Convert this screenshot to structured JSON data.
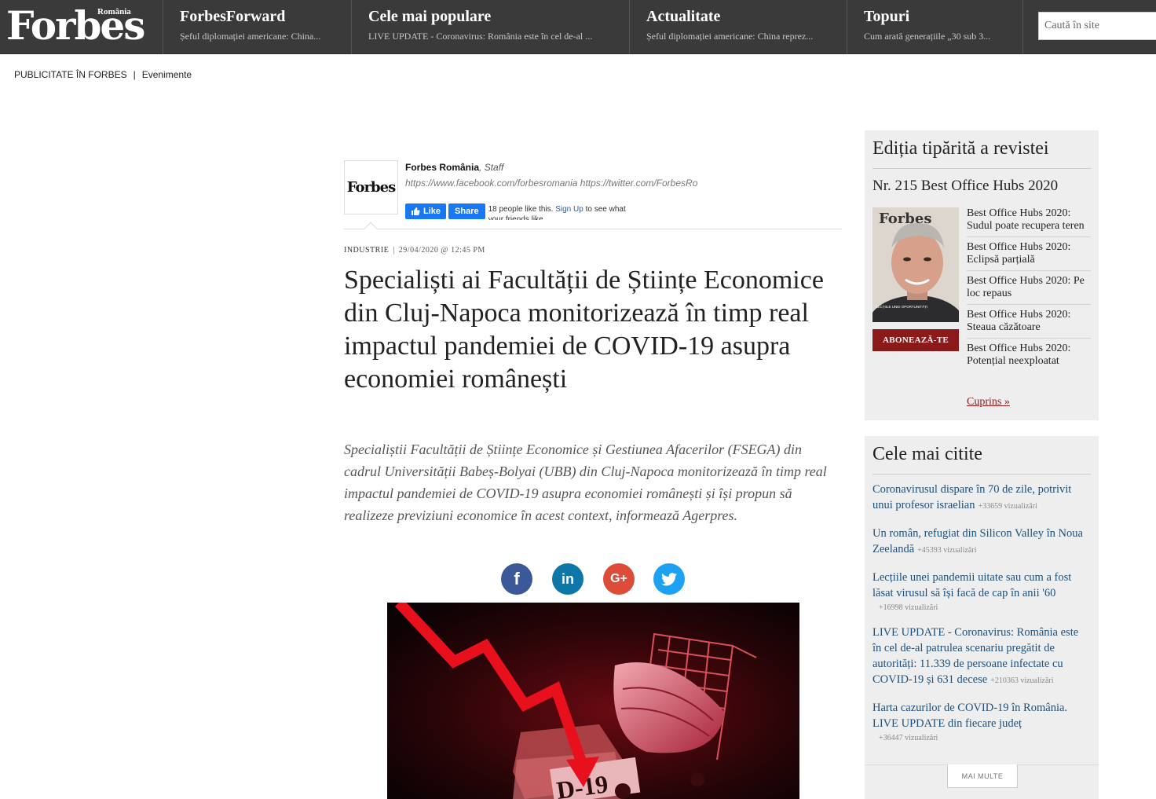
{
  "header": {
    "logo": "Forbes",
    "logo_country": "România",
    "nav": [
      {
        "title": "ForbesForward",
        "subtitle": "Șeful diplomației americane: China..."
      },
      {
        "title": "Cele mai populare",
        "subtitle": "LIVE UPDATE - Coronavirus: România este în cel de-al ..."
      },
      {
        "title": "Actualitate",
        "subtitle": "Șeful diplomației americane: China reprez..."
      },
      {
        "title": "Topuri",
        "subtitle": "Cum arată generațiile „30 sub 3..."
      }
    ],
    "search_placeholder": "Caută în site"
  },
  "subnav": {
    "advertising": "PUBLICITATE ÎN FORBES",
    "separator": "|",
    "events": "Evenimente"
  },
  "author": {
    "avatar_logo": "Forbes",
    "name": "Forbes România",
    "role": ", Staff",
    "links": "https://www.facebook.com/forbesromania https://twitter.com/ForbesRo",
    "fb_like": "Like",
    "fb_share": "Share",
    "fb_count_text": "18 people like this.",
    "fb_signup": "Sign Up",
    "fb_rest": "to see what your friends like."
  },
  "article": {
    "category": "INDUSTRIE",
    "separator": "|",
    "date": "29/04/2020 @ 12:45 PM",
    "headline": "Specialiști ai Facultății de Științe Economice din Cluj-Napoca monitorizează în timp real impactul pandemiei de COVID-19 asupra economiei românești",
    "lede": "Specialiștii Facultății de Științe Economice și Gestiunea Afacerilor (FSEGA) din cadrul Universității Babeș-Bolyai (UBB) din Cluj-Napoca monitorizează în timp real impactul pandemiei de COVID-19 asupra economiei românești și își propun să realizeze previziuni economice în acest context, informează Agerpres."
  },
  "share": {
    "facebook": "f",
    "linkedin": "in",
    "googleplus": "G+",
    "twitter_icon": "twitter-bird"
  },
  "print_edition": {
    "title": "Ediția tipărită a revistei",
    "issue": "Nr. 215 Best Office Hubs 2020",
    "cover_logo": "Forbes",
    "cover_caption": "LECȚIILE UNEI OPORTUNITĂȚI",
    "subscribe": "ABONEAZĂ-TE",
    "items": [
      "Best Office Hubs 2020: Sudul poate recupera teren",
      "Best Office Hubs 2020: Eclipsă parțială",
      "Best Office Hubs 2020: Pe loc repaus",
      "Best Office Hubs 2020: Steaua căzătoare",
      "Best Office Hubs 2020: Potențial neexploatat"
    ],
    "contents_link": "Cuprins »"
  },
  "most_read": {
    "title": "Cele mai citite",
    "items": [
      {
        "title": "Coronavirusul dispare în 70 de zile, potrivit unui profesor israelian",
        "views": "+33659 vizualizări"
      },
      {
        "title": "Un român, refugiat din Silicon Valley în Noua Zeelandă",
        "views": "+45393 vizualizări"
      },
      {
        "title": "Lecțiile unei pandemii uitate sau cum a fost lăsat virusul să își facă de cap în anii '60",
        "views": "+16998 vizualizări"
      },
      {
        "title": "LIVE UPDATE - Coronavirus: România este în cel de-al patrulea scenariu pregătit de autorități: 11.339 de persoane infectate cu COVID-19 și 631 decese",
        "views": "+210363 vizualizări"
      },
      {
        "title": "Harta cazurilor de COVID-19 în România. LIVE UPDATE din fiecare județ",
        "views": "+36447 vizualizări"
      }
    ],
    "more": "MAI MULTE"
  },
  "hero_image": {
    "label": "D-19"
  }
}
